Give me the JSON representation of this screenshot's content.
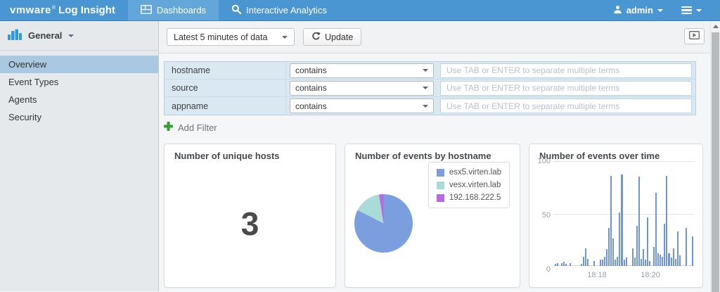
{
  "navbar": {
    "brand": "vmware",
    "brand_mark": "®",
    "product": "Log Insight",
    "tabs": [
      {
        "label": "Dashboards",
        "active": true
      },
      {
        "label": "Interactive Analytics",
        "active": false
      }
    ],
    "user": "admin"
  },
  "sidebar": {
    "group": "General",
    "items": [
      {
        "label": "Overview",
        "active": true
      },
      {
        "label": "Event Types",
        "active": false
      },
      {
        "label": "Agents",
        "active": false
      },
      {
        "label": "Security",
        "active": false
      }
    ]
  },
  "toolbar": {
    "time_range": "Latest 5 minutes of data",
    "update_label": "Update"
  },
  "filters": {
    "placeholder": "Use TAB or ENTER to separate multiple terms",
    "add_label": "Add Filter",
    "rows": [
      {
        "field": "hostname",
        "operator": "contains",
        "value": ""
      },
      {
        "field": "source",
        "operator": "contains",
        "value": ""
      },
      {
        "field": "appname",
        "operator": "contains",
        "value": ""
      }
    ]
  },
  "chart_data": [
    {
      "type": "value",
      "title": "Number of unique hosts",
      "value": "3"
    },
    {
      "type": "pie",
      "title": "Number of events by hostname",
      "labels": [
        "esx5.virten.lab",
        "vesx.virten.lab",
        "192.168.222.5"
      ],
      "values_pct": [
        82.5,
        15,
        2.5
      ],
      "colors": [
        "#7b9ede",
        "#a9dcd9",
        "#b968e8"
      ],
      "legend_position": "top-right"
    },
    {
      "type": "bar",
      "title": "Number of events over time",
      "ylim": [
        0,
        100
      ],
      "yticks": [
        0,
        50,
        100
      ],
      "x_ticks": [
        {
          "label": "18:18",
          "pos_pct": 31
        },
        {
          "label": "18:20",
          "pos_pct": 69
        }
      ],
      "color": "#7095d6",
      "grid": true,
      "values": [
        2,
        3,
        0,
        3,
        4,
        2,
        0,
        3,
        0,
        0,
        0,
        0,
        2,
        9,
        17,
        7,
        0,
        0,
        5,
        0,
        0,
        6,
        6,
        9,
        16,
        36,
        86,
        26,
        6,
        9,
        51,
        87,
        6,
        8,
        0,
        0,
        17,
        8,
        38,
        85,
        7,
        16,
        6,
        46,
        5,
        0,
        18,
        70,
        12,
        11,
        9,
        40,
        86,
        12,
        8,
        17,
        7,
        33,
        10,
        0,
        0,
        36,
        0,
        0,
        28
      ]
    }
  ],
  "colors": {
    "navbar_bg": "#4a96d2",
    "navbar_active_tab": "#63a6da",
    "sidebar_selected": "#a9c8e1",
    "filter_row_bg": "#d9e8f1",
    "add_filter_green": "#2fa02f",
    "bar_color": "#7095d6"
  }
}
